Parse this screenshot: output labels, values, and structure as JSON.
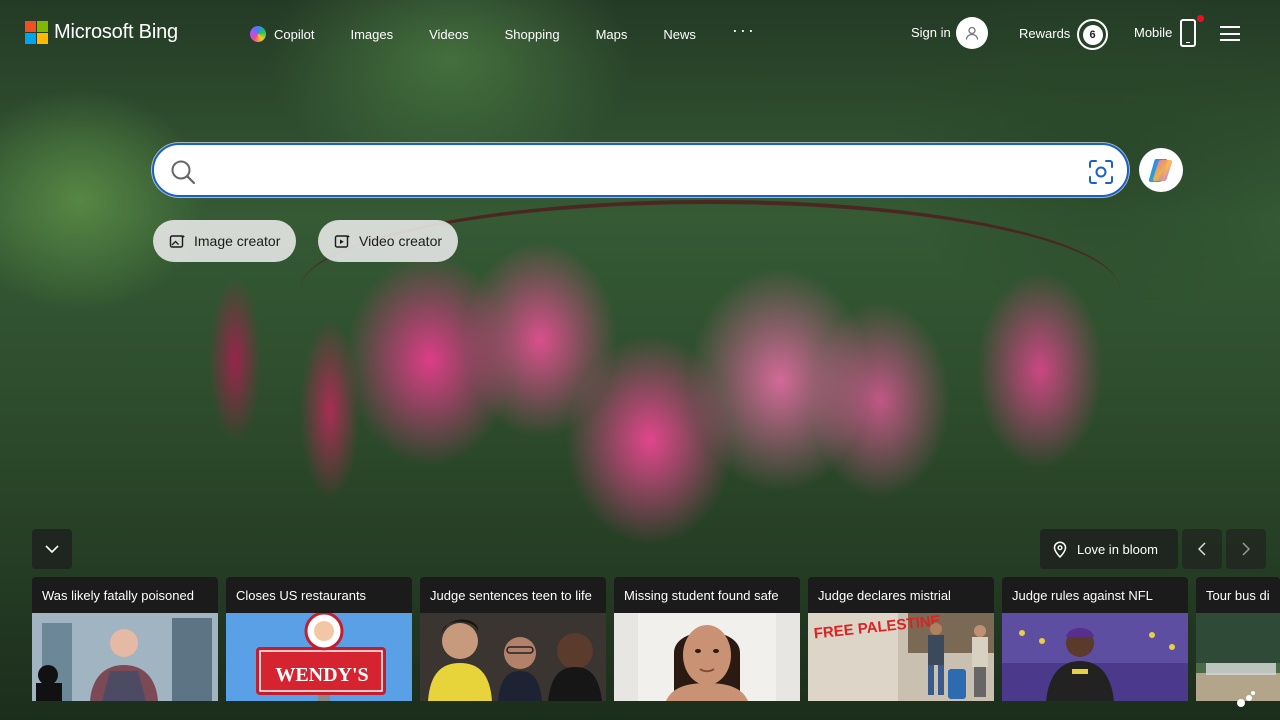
{
  "brand": {
    "name": "Microsoft Bing",
    "logo_colors": [
      "#f25022",
      "#7fba00",
      "#00a4ef",
      "#ffb900"
    ]
  },
  "nav": {
    "items": [
      {
        "label": "Copilot",
        "icon": "copilot-icon"
      },
      {
        "label": "Images"
      },
      {
        "label": "Videos"
      },
      {
        "label": "Shopping"
      },
      {
        "label": "Maps"
      },
      {
        "label": "News"
      }
    ],
    "more": "···"
  },
  "account": {
    "sign_in": "Sign in",
    "rewards": "Rewards",
    "rewards_points": "6",
    "mobile": "Mobile"
  },
  "search": {
    "value": "",
    "placeholder": "",
    "accent": "#1a5fd1"
  },
  "creators": {
    "image": "Image creator",
    "video": "Video creator"
  },
  "background": {
    "location_label": "Love in bloom"
  },
  "news": [
    {
      "title": "Was likely fatally poisoned"
    },
    {
      "title": "Closes US restaurants"
    },
    {
      "title": "Judge sentences teen to life"
    },
    {
      "title": "Missing student found safe"
    },
    {
      "title": "Judge declares mistrial"
    },
    {
      "title": "Judge rules against NFL"
    },
    {
      "title": "Tour bus di"
    }
  ],
  "news_images": {
    "wendys_sign_text": "WENDY'S",
    "graffiti_text": "FREE PALESTINE"
  }
}
